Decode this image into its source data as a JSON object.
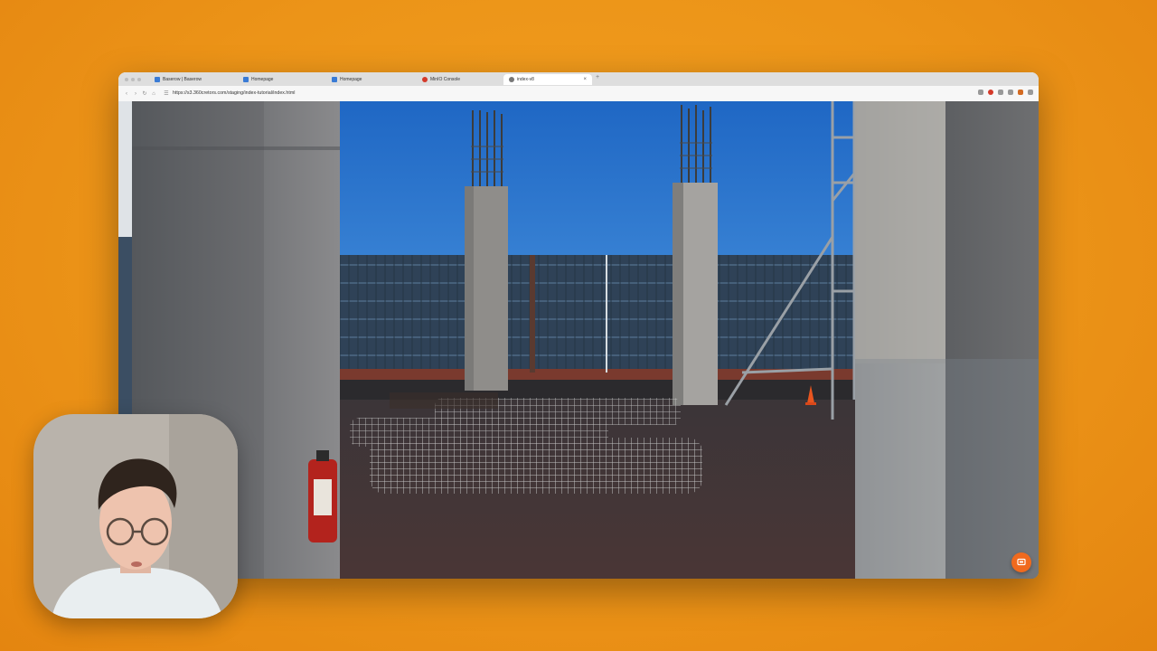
{
  "browser": {
    "tabs": [
      {
        "title": "Baserow | Baserow",
        "icon": "baserow-favicon"
      },
      {
        "title": "Homepage",
        "icon": "page-favicon"
      },
      {
        "title": "Homepage",
        "icon": "page-favicon"
      },
      {
        "title": "MinIO Console",
        "icon": "minio-favicon"
      },
      {
        "title": "index-v8",
        "icon": "globe-favicon",
        "active": true
      }
    ],
    "new_tab_label": "+",
    "close_label": "×",
    "url": "https://s3.360cretors.com/staging/index-tutorial/index.html"
  },
  "scene": {
    "description_icon": "panorama-360-viewer",
    "accent_color": "#f06a1e"
  },
  "webcam": {
    "icon": "presenter-webcam"
  }
}
